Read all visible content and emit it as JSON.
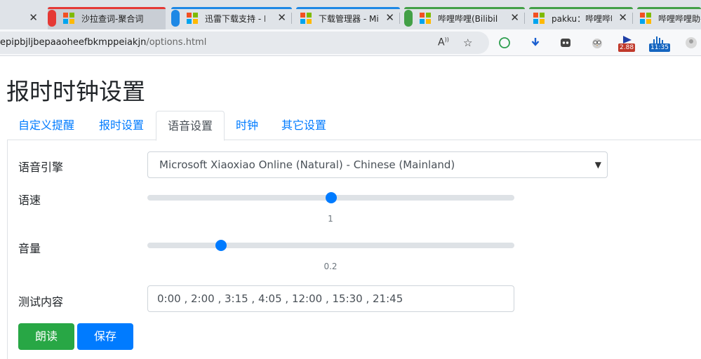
{
  "browser": {
    "tabs": [
      {
        "title": "",
        "favicon": "close-icon"
      },
      {
        "title": "沙拉查词-聚合词",
        "favicon": "microsoft-logo-icon",
        "accent": "#e53935"
      },
      {
        "title": "迅雷下载支持 - M",
        "favicon": "microsoft-logo-icon",
        "accent": "#1e88e5"
      },
      {
        "title": "下载管理器 - Mi",
        "favicon": "microsoft-logo-icon"
      },
      {
        "title": "哔哩哔哩(Bilibili",
        "favicon": "microsoft-logo-icon",
        "accent": "#43a047"
      },
      {
        "title": "pakku：哔哩哔哩",
        "favicon": "microsoft-logo-icon"
      },
      {
        "title": "哔哩哔哩助手",
        "favicon": "microsoft-logo-icon"
      }
    ],
    "url_main": "epipbjljbepaaoheefbkmppeiakjn",
    "url_path": "/options.html",
    "extensions": [
      {
        "icon": "circle-outline-icon"
      },
      {
        "icon": "download-arrow-icon"
      },
      {
        "icon": "robot-face-icon"
      },
      {
        "icon": "owl-icon"
      },
      {
        "icon": "play-flag-icon",
        "badge": "2.88",
        "badge_color": "#c0392b"
      },
      {
        "icon": "bar-equalizer-icon",
        "badge": "11:35",
        "badge_color": "#1565c0"
      }
    ]
  },
  "page": {
    "title": "报时时钟设置",
    "tabs": [
      "自定义提醒",
      "报时设置",
      "语音设置",
      "时钟",
      "其它设置"
    ],
    "active_tab_index": 2,
    "form": {
      "engine_label": "语音引擎",
      "engine_value": "Microsoft Xiaoxiao Online (Natural) - Chinese (Mainland)",
      "rate_label": "语速",
      "rate_value": "1",
      "rate_fraction": 0.5,
      "volume_label": "音量",
      "volume_value": "0.2",
      "volume_fraction": 0.2,
      "test_label": "测试内容",
      "test_value": "0:00 , 2:00 , 3:15 , 4:05 , 12:00 , 15:30 , 21:45",
      "read_button": "朗读",
      "save_button": "保存"
    }
  },
  "colors": {
    "primary": "#007bff",
    "success": "#28a745"
  }
}
